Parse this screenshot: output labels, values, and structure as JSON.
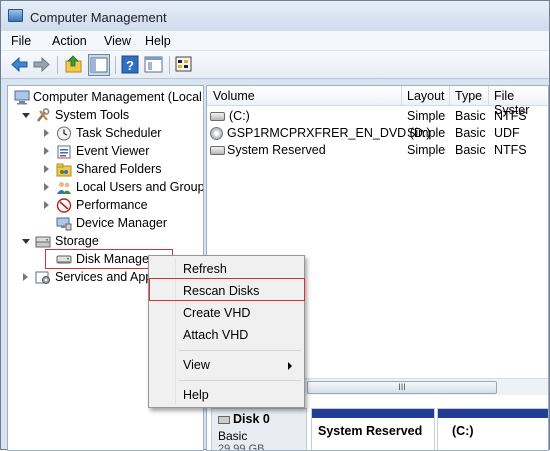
{
  "window": {
    "title": "Computer Management"
  },
  "menubar": {
    "items": [
      "File",
      "Action",
      "View",
      "Help"
    ]
  },
  "toolbar": {
    "buttons": [
      "back-arrow-icon",
      "forward-arrow-icon",
      "up-folder-icon",
      "show-hide-tree-icon",
      "help-icon",
      "properties-icon",
      "console-settings-icon"
    ]
  },
  "tree": {
    "root": "Computer Management (Local",
    "system_tools": "System Tools",
    "task_scheduler": "Task Scheduler",
    "event_viewer": "Event Viewer",
    "shared_folders": "Shared Folders",
    "local_users": "Local Users and Groups",
    "performance": "Performance",
    "device_manager": "Device Manager",
    "storage": "Storage",
    "disk_management": "Disk Manager",
    "services": "Services and App"
  },
  "volumes": {
    "headers": [
      "Volume",
      "Layout",
      "Type",
      "File Syster"
    ],
    "rows": [
      {
        "volume": "(C:)",
        "layout": "Simple",
        "type": "Basic",
        "fs": "NTFS"
      },
      {
        "volume": "GSP1RMCPRXFRER_EN_DVD (D:)",
        "layout": "Simple",
        "type": "Basic",
        "fs": "UDF"
      },
      {
        "volume": "System Reserved",
        "layout": "Simple",
        "type": "Basic",
        "fs": "NTFS"
      }
    ]
  },
  "scrollbar": {
    "grip": "III"
  },
  "disk": {
    "name": "Disk 0",
    "kind": "Basic",
    "size_partial": "29.99 GB",
    "partitions": [
      "System Reserved",
      "(C:)"
    ]
  },
  "context_menu": {
    "refresh": "Refresh",
    "rescan": "Rescan Disks",
    "create_vhd": "Create VHD",
    "attach_vhd": "Attach VHD",
    "view": "View",
    "help": "Help"
  },
  "colors": {
    "highlight_box": "#d3313b",
    "partition_bar": "#213e94"
  }
}
